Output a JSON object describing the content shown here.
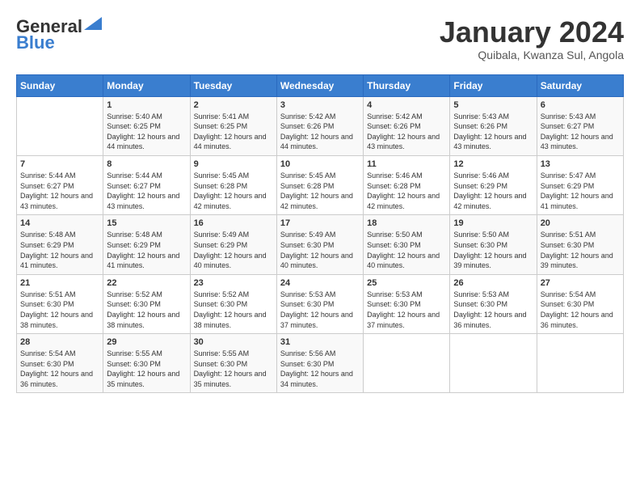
{
  "header": {
    "logo_line1": "General",
    "logo_line2": "Blue",
    "month": "January 2024",
    "location": "Quibala, Kwanza Sul, Angola"
  },
  "weekdays": [
    "Sunday",
    "Monday",
    "Tuesday",
    "Wednesday",
    "Thursday",
    "Friday",
    "Saturday"
  ],
  "weeks": [
    [
      {
        "day": "",
        "sunrise": "",
        "sunset": "",
        "daylight": ""
      },
      {
        "day": "1",
        "sunrise": "Sunrise: 5:40 AM",
        "sunset": "Sunset: 6:25 PM",
        "daylight": "Daylight: 12 hours and 44 minutes."
      },
      {
        "day": "2",
        "sunrise": "Sunrise: 5:41 AM",
        "sunset": "Sunset: 6:25 PM",
        "daylight": "Daylight: 12 hours and 44 minutes."
      },
      {
        "day": "3",
        "sunrise": "Sunrise: 5:42 AM",
        "sunset": "Sunset: 6:26 PM",
        "daylight": "Daylight: 12 hours and 44 minutes."
      },
      {
        "day": "4",
        "sunrise": "Sunrise: 5:42 AM",
        "sunset": "Sunset: 6:26 PM",
        "daylight": "Daylight: 12 hours and 43 minutes."
      },
      {
        "day": "5",
        "sunrise": "Sunrise: 5:43 AM",
        "sunset": "Sunset: 6:26 PM",
        "daylight": "Daylight: 12 hours and 43 minutes."
      },
      {
        "day": "6",
        "sunrise": "Sunrise: 5:43 AM",
        "sunset": "Sunset: 6:27 PM",
        "daylight": "Daylight: 12 hours and 43 minutes."
      }
    ],
    [
      {
        "day": "7",
        "sunrise": "Sunrise: 5:44 AM",
        "sunset": "Sunset: 6:27 PM",
        "daylight": "Daylight: 12 hours and 43 minutes."
      },
      {
        "day": "8",
        "sunrise": "Sunrise: 5:44 AM",
        "sunset": "Sunset: 6:27 PM",
        "daylight": "Daylight: 12 hours and 43 minutes."
      },
      {
        "day": "9",
        "sunrise": "Sunrise: 5:45 AM",
        "sunset": "Sunset: 6:28 PM",
        "daylight": "Daylight: 12 hours and 42 minutes."
      },
      {
        "day": "10",
        "sunrise": "Sunrise: 5:45 AM",
        "sunset": "Sunset: 6:28 PM",
        "daylight": "Daylight: 12 hours and 42 minutes."
      },
      {
        "day": "11",
        "sunrise": "Sunrise: 5:46 AM",
        "sunset": "Sunset: 6:28 PM",
        "daylight": "Daylight: 12 hours and 42 minutes."
      },
      {
        "day": "12",
        "sunrise": "Sunrise: 5:46 AM",
        "sunset": "Sunset: 6:29 PM",
        "daylight": "Daylight: 12 hours and 42 minutes."
      },
      {
        "day": "13",
        "sunrise": "Sunrise: 5:47 AM",
        "sunset": "Sunset: 6:29 PM",
        "daylight": "Daylight: 12 hours and 41 minutes."
      }
    ],
    [
      {
        "day": "14",
        "sunrise": "Sunrise: 5:48 AM",
        "sunset": "Sunset: 6:29 PM",
        "daylight": "Daylight: 12 hours and 41 minutes."
      },
      {
        "day": "15",
        "sunrise": "Sunrise: 5:48 AM",
        "sunset": "Sunset: 6:29 PM",
        "daylight": "Daylight: 12 hours and 41 minutes."
      },
      {
        "day": "16",
        "sunrise": "Sunrise: 5:49 AM",
        "sunset": "Sunset: 6:29 PM",
        "daylight": "Daylight: 12 hours and 40 minutes."
      },
      {
        "day": "17",
        "sunrise": "Sunrise: 5:49 AM",
        "sunset": "Sunset: 6:30 PM",
        "daylight": "Daylight: 12 hours and 40 minutes."
      },
      {
        "day": "18",
        "sunrise": "Sunrise: 5:50 AM",
        "sunset": "Sunset: 6:30 PM",
        "daylight": "Daylight: 12 hours and 40 minutes."
      },
      {
        "day": "19",
        "sunrise": "Sunrise: 5:50 AM",
        "sunset": "Sunset: 6:30 PM",
        "daylight": "Daylight: 12 hours and 39 minutes."
      },
      {
        "day": "20",
        "sunrise": "Sunrise: 5:51 AM",
        "sunset": "Sunset: 6:30 PM",
        "daylight": "Daylight: 12 hours and 39 minutes."
      }
    ],
    [
      {
        "day": "21",
        "sunrise": "Sunrise: 5:51 AM",
        "sunset": "Sunset: 6:30 PM",
        "daylight": "Daylight: 12 hours and 38 minutes."
      },
      {
        "day": "22",
        "sunrise": "Sunrise: 5:52 AM",
        "sunset": "Sunset: 6:30 PM",
        "daylight": "Daylight: 12 hours and 38 minutes."
      },
      {
        "day": "23",
        "sunrise": "Sunrise: 5:52 AM",
        "sunset": "Sunset: 6:30 PM",
        "daylight": "Daylight: 12 hours and 38 minutes."
      },
      {
        "day": "24",
        "sunrise": "Sunrise: 5:53 AM",
        "sunset": "Sunset: 6:30 PM",
        "daylight": "Daylight: 12 hours and 37 minutes."
      },
      {
        "day": "25",
        "sunrise": "Sunrise: 5:53 AM",
        "sunset": "Sunset: 6:30 PM",
        "daylight": "Daylight: 12 hours and 37 minutes."
      },
      {
        "day": "26",
        "sunrise": "Sunrise: 5:53 AM",
        "sunset": "Sunset: 6:30 PM",
        "daylight": "Daylight: 12 hours and 36 minutes."
      },
      {
        "day": "27",
        "sunrise": "Sunrise: 5:54 AM",
        "sunset": "Sunset: 6:30 PM",
        "daylight": "Daylight: 12 hours and 36 minutes."
      }
    ],
    [
      {
        "day": "28",
        "sunrise": "Sunrise: 5:54 AM",
        "sunset": "Sunset: 6:30 PM",
        "daylight": "Daylight: 12 hours and 36 minutes."
      },
      {
        "day": "29",
        "sunrise": "Sunrise: 5:55 AM",
        "sunset": "Sunset: 6:30 PM",
        "daylight": "Daylight: 12 hours and 35 minutes."
      },
      {
        "day": "30",
        "sunrise": "Sunrise: 5:55 AM",
        "sunset": "Sunset: 6:30 PM",
        "daylight": "Daylight: 12 hours and 35 minutes."
      },
      {
        "day": "31",
        "sunrise": "Sunrise: 5:56 AM",
        "sunset": "Sunset: 6:30 PM",
        "daylight": "Daylight: 12 hours and 34 minutes."
      },
      {
        "day": "",
        "sunrise": "",
        "sunset": "",
        "daylight": ""
      },
      {
        "day": "",
        "sunrise": "",
        "sunset": "",
        "daylight": ""
      },
      {
        "day": "",
        "sunrise": "",
        "sunset": "",
        "daylight": ""
      }
    ]
  ]
}
